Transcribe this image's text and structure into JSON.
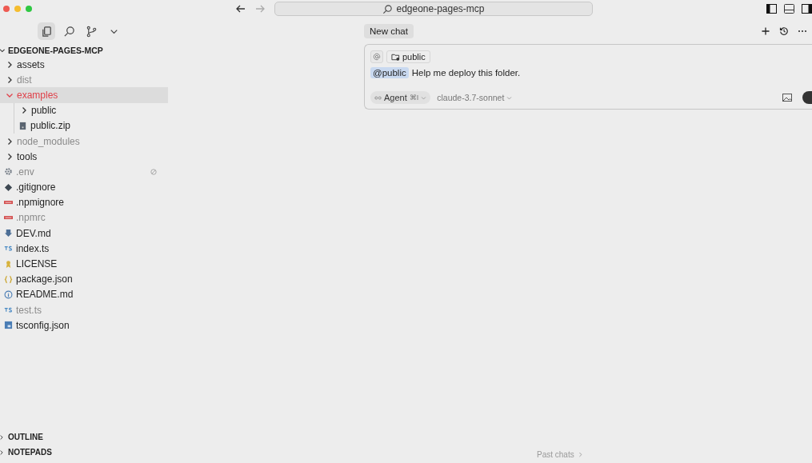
{
  "window": {
    "title": "edgeone-pages-mcp"
  },
  "explorer": {
    "root": "EDGEONE-PAGES-MCP",
    "expanded": true,
    "items": [
      {
        "name": "assets",
        "kind": "folder",
        "expanded": false,
        "dimmed": false,
        "selected": false
      },
      {
        "name": "dist",
        "kind": "folder",
        "expanded": false,
        "dimmed": true,
        "selected": false
      },
      {
        "name": "examples",
        "kind": "folder",
        "expanded": true,
        "dimmed": false,
        "selected": true,
        "children": [
          {
            "name": "public",
            "kind": "folder",
            "expanded": false,
            "dimmed": false,
            "selected": false
          },
          {
            "name": "public.zip",
            "kind": "zip",
            "dimmed": false,
            "selected": false
          }
        ]
      },
      {
        "name": "node_modules",
        "kind": "folder",
        "expanded": false,
        "dimmed": true,
        "selected": false
      },
      {
        "name": "tools",
        "kind": "folder",
        "expanded": false,
        "dimmed": false,
        "selected": false
      },
      {
        "name": ".env",
        "kind": "gear",
        "dimmed": true,
        "selected": false,
        "ignored": true
      },
      {
        "name": ".gitignore",
        "kind": "git",
        "dimmed": false,
        "selected": false
      },
      {
        "name": ".npmignore",
        "kind": "npm",
        "dimmed": false,
        "selected": false
      },
      {
        "name": ".npmrc",
        "kind": "npm",
        "dimmed": true,
        "selected": false
      },
      {
        "name": "DEV.md",
        "kind": "download",
        "dimmed": false,
        "selected": false
      },
      {
        "name": "index.ts",
        "kind": "ts",
        "dimmed": false,
        "selected": false
      },
      {
        "name": "LICENSE",
        "kind": "license",
        "dimmed": false,
        "selected": false
      },
      {
        "name": "package.json",
        "kind": "json",
        "dimmed": false,
        "selected": false
      },
      {
        "name": "README.md",
        "kind": "info",
        "dimmed": false,
        "selected": false
      },
      {
        "name": "test.ts",
        "kind": "ts",
        "dimmed": true,
        "selected": false
      },
      {
        "name": "tsconfig.json",
        "kind": "tsconfig",
        "dimmed": false,
        "selected": false
      }
    ]
  },
  "panels": [
    {
      "label": "OUTLINE"
    },
    {
      "label": "NOTEPADS"
    }
  ],
  "chat": {
    "tab": "New chat",
    "context_chip": "public",
    "mention": "@public",
    "message": "Help me deploy this folder.",
    "mode": "Agent",
    "mode_shortcut": "⌘I",
    "model": "claude-3.7-sonnet",
    "past_chats": "Past chats"
  }
}
